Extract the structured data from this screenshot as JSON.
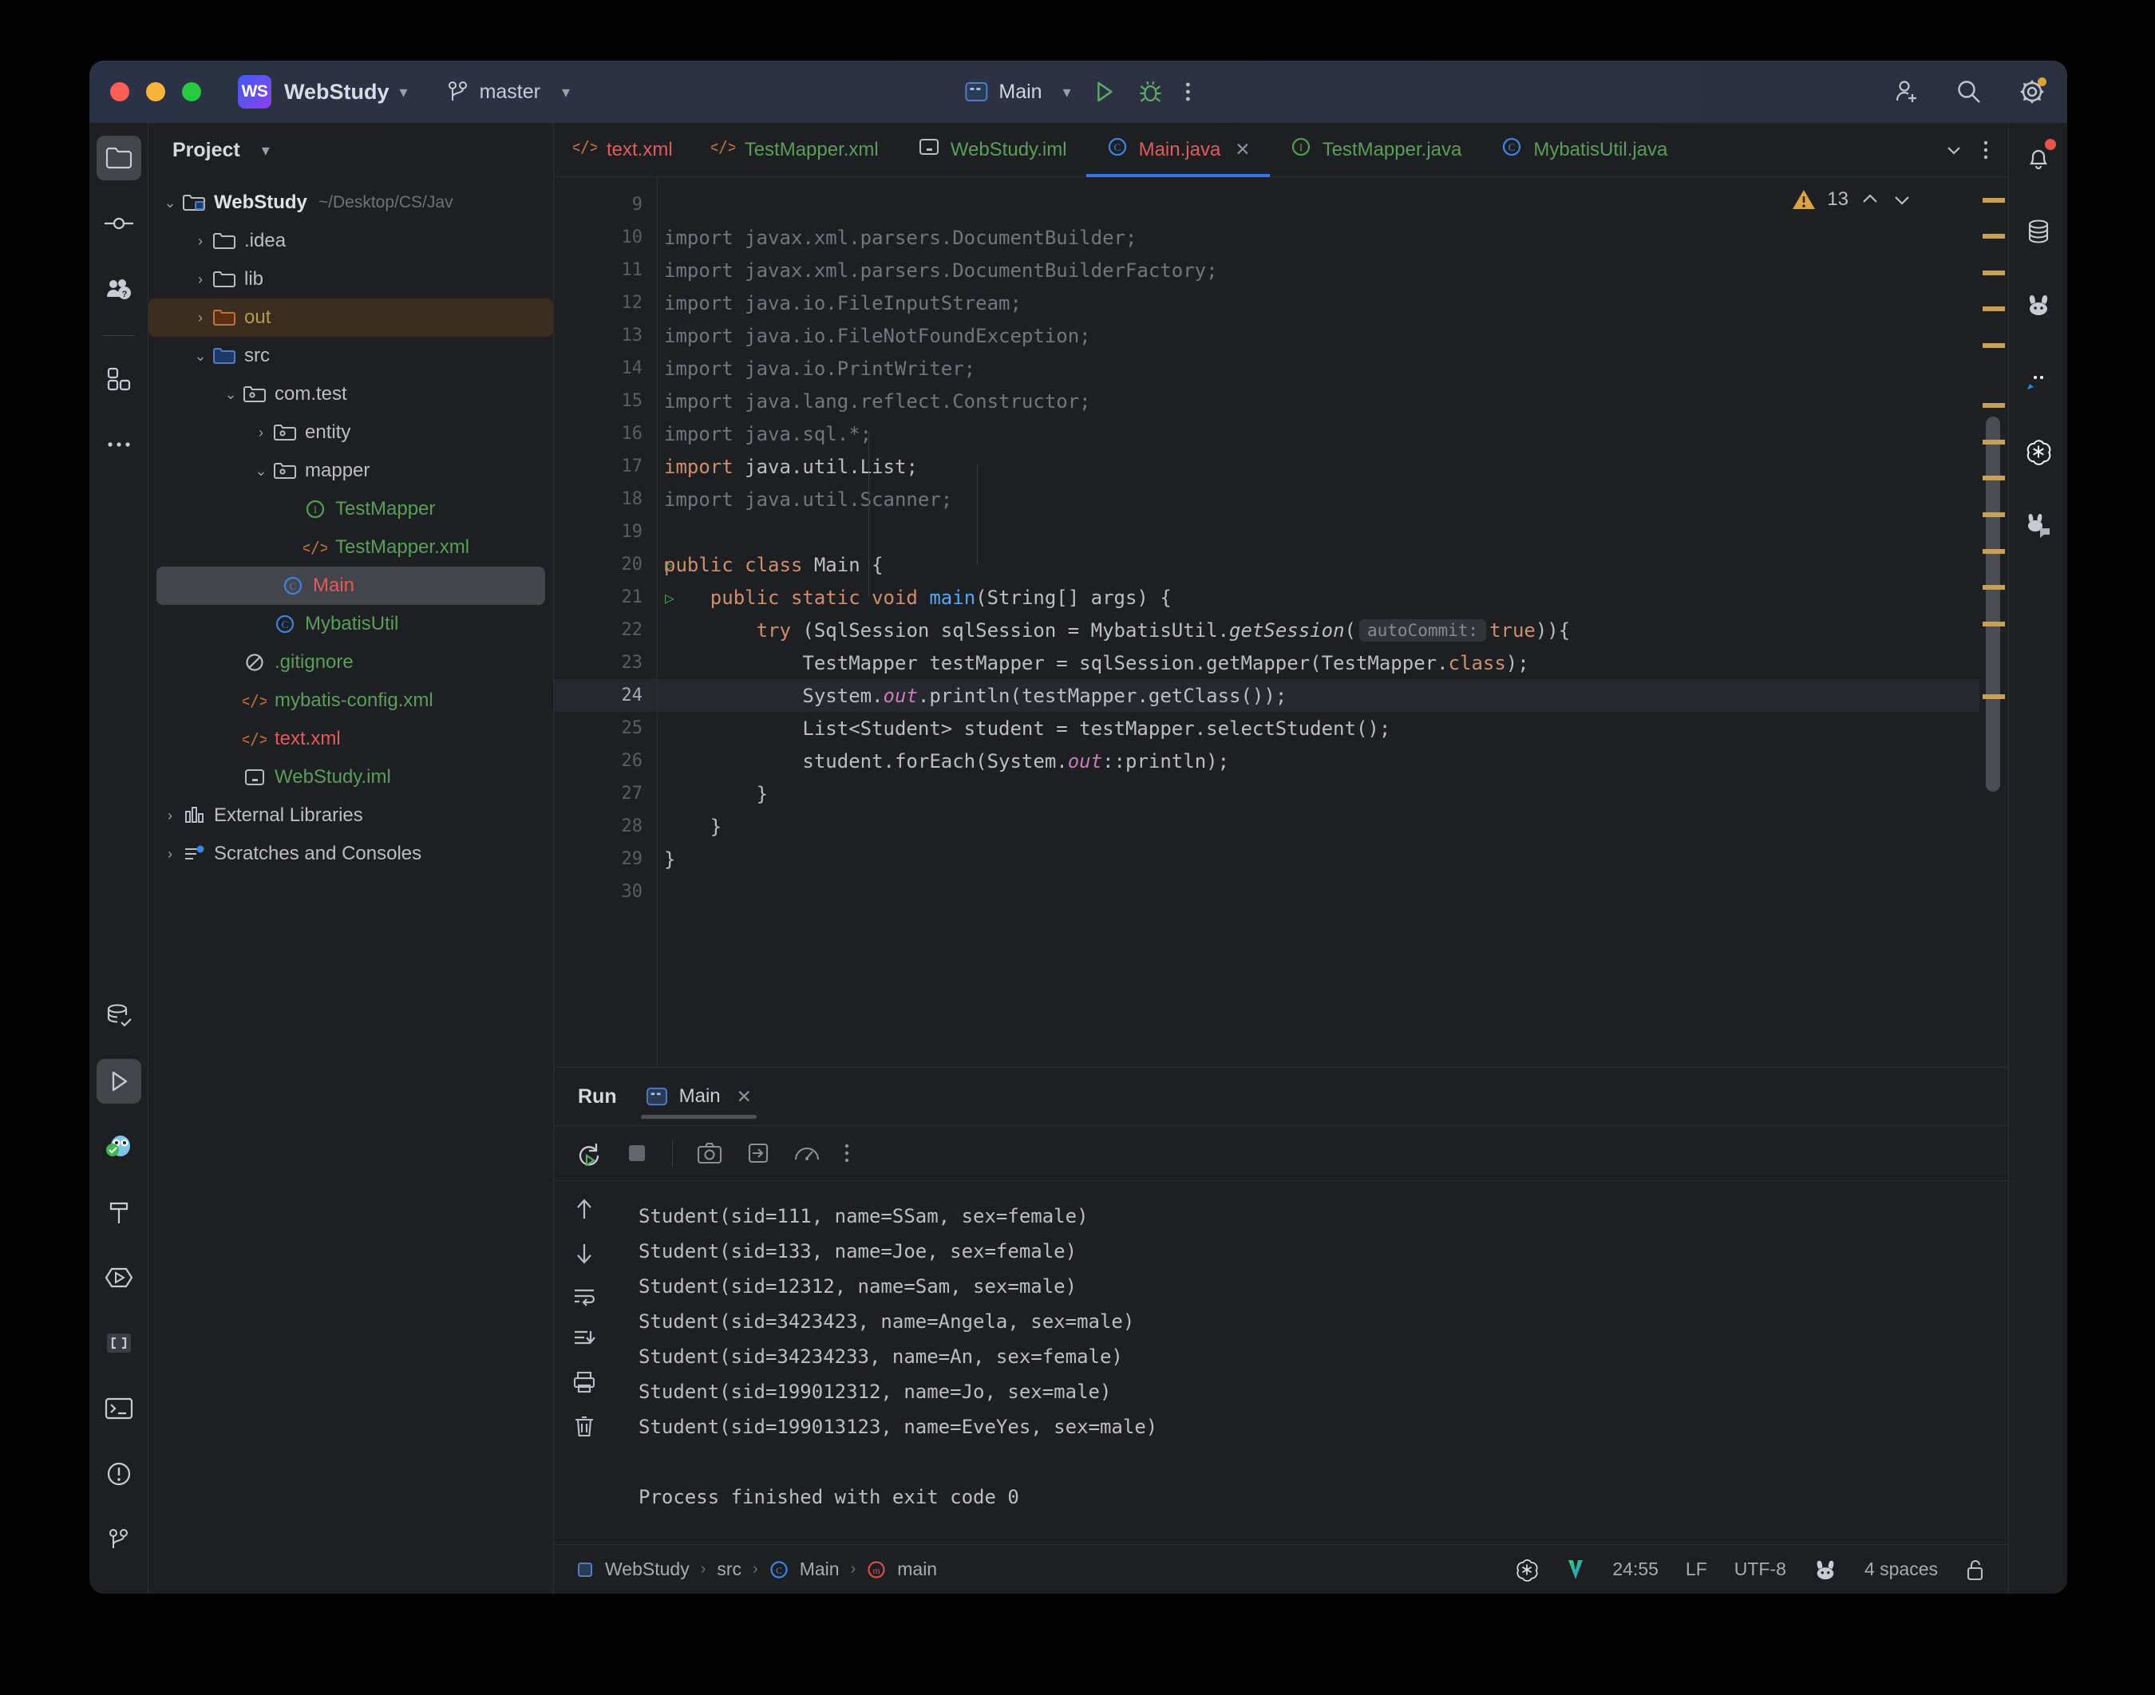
{
  "titlebar": {
    "app_badge": "WS",
    "project": "WebStudy",
    "branch": "master",
    "run_config": "Main",
    "icons": [
      "run-icon",
      "debug-icon",
      "more-actions-icon",
      "add-user-icon",
      "search-icon",
      "settings-icon"
    ]
  },
  "left_rail": {
    "items": [
      "project-icon",
      "commit-icon",
      "pull-requests-icon",
      "plugins-icon",
      "more-tool-windows-icon"
    ],
    "bottom": [
      "database-icon",
      "run-icon",
      "go-plugin-icon",
      "build-icon",
      "services-icon",
      "structure-icon",
      "terminal-icon",
      "problems-icon",
      "git-icon"
    ]
  },
  "project_panel": {
    "title": "Project",
    "tree": [
      {
        "label": "WebStudy",
        "path": "~/Desktop/CS/Jav",
        "depth": 0,
        "twisty": "down",
        "icon": "module-icon",
        "style": "bold"
      },
      {
        "label": ".idea",
        "depth": 1,
        "twisty": "right",
        "icon": "folder-icon",
        "style": "plain"
      },
      {
        "label": "lib",
        "depth": 1,
        "twisty": "right",
        "icon": "folder-icon",
        "style": "plain"
      },
      {
        "label": "out",
        "depth": 1,
        "twisty": "right",
        "icon": "folder-excluded-icon",
        "style": "yellow",
        "selected": "orange"
      },
      {
        "label": "src",
        "depth": 1,
        "twisty": "down",
        "icon": "folder-source-icon",
        "style": "plain"
      },
      {
        "label": "com.test",
        "depth": 2,
        "twisty": "down",
        "icon": "package-icon",
        "style": "plain"
      },
      {
        "label": "entity",
        "depth": 3,
        "twisty": "right",
        "icon": "package-icon",
        "style": "plain"
      },
      {
        "label": "mapper",
        "depth": 3,
        "twisty": "down",
        "icon": "package-icon",
        "style": "plain"
      },
      {
        "label": "TestMapper",
        "depth": 4,
        "twisty": "none",
        "icon": "interface-icon",
        "style": "green"
      },
      {
        "label": "TestMapper.xml",
        "depth": 4,
        "twisty": "none",
        "icon": "xml-icon",
        "style": "green"
      },
      {
        "label": "Main",
        "depth": 3,
        "twisty": "none",
        "icon": "class-icon",
        "style": "red",
        "selected": "grey"
      },
      {
        "label": "MybatisUtil",
        "depth": 3,
        "twisty": "none",
        "icon": "class-icon",
        "style": "green"
      },
      {
        "label": ".gitignore",
        "depth": 2,
        "twisty": "none",
        "icon": "gitignore-icon",
        "style": "green"
      },
      {
        "label": "mybatis-config.xml",
        "depth": 2,
        "twisty": "none",
        "icon": "xml-icon",
        "style": "green"
      },
      {
        "label": "text.xml",
        "depth": 2,
        "twisty": "none",
        "icon": "xml-icon",
        "style": "red"
      },
      {
        "label": "WebStudy.iml",
        "depth": 2,
        "twisty": "none",
        "icon": "iml-icon",
        "style": "green"
      },
      {
        "label": "External Libraries",
        "depth": 0,
        "twisty": "right",
        "icon": "libraries-icon",
        "style": "plain"
      },
      {
        "label": "Scratches and Consoles",
        "depth": 0,
        "twisty": "right",
        "icon": "scratches-icon",
        "style": "plain"
      }
    ]
  },
  "editor": {
    "tabs": [
      {
        "label": "text.xml",
        "icon": "xml-icon",
        "color": "red",
        "active": false
      },
      {
        "label": "TestMapper.xml",
        "icon": "xml-icon",
        "color": "green",
        "active": false
      },
      {
        "label": "WebStudy.iml",
        "icon": "iml-icon",
        "color": "green",
        "active": false
      },
      {
        "label": "Main.java",
        "icon": "class-icon",
        "color": "red",
        "active": true
      },
      {
        "label": "TestMapper.java",
        "icon": "interface-icon",
        "color": "green",
        "active": false
      },
      {
        "label": "MybatisUtil.java",
        "icon": "class-icon",
        "color": "green",
        "active": false
      }
    ],
    "warning_count": "13",
    "first_line_number": 9,
    "current_line": 24,
    "lines": [
      {
        "n": 9,
        "segs": []
      },
      {
        "n": 10,
        "segs": [
          {
            "t": "import javax.xml.parsers.DocumentBuilder;",
            "c": "dim"
          }
        ]
      },
      {
        "n": 11,
        "segs": [
          {
            "t": "import javax.xml.parsers.DocumentBuilderFactory;",
            "c": "dim"
          }
        ]
      },
      {
        "n": 12,
        "segs": [
          {
            "t": "import java.io.FileInputStream;",
            "c": "dim"
          }
        ]
      },
      {
        "n": 13,
        "segs": [
          {
            "t": "import java.io.FileNotFoundException;",
            "c": "dim"
          }
        ]
      },
      {
        "n": 14,
        "segs": [
          {
            "t": "import java.io.PrintWriter;",
            "c": "dim"
          }
        ]
      },
      {
        "n": 15,
        "segs": [
          {
            "t": "import java.lang.reflect.Constructor;",
            "c": "dim"
          }
        ]
      },
      {
        "n": 16,
        "segs": [
          {
            "t": "import java.sql.*;",
            "c": "dim"
          }
        ]
      },
      {
        "n": 17,
        "segs": [
          {
            "t": "import",
            "c": "kw"
          },
          {
            "t": " java.util.List;",
            "c": "plain"
          }
        ]
      },
      {
        "n": 18,
        "segs": [
          {
            "t": "import java.util.Scanner;",
            "c": "dim"
          }
        ]
      },
      {
        "n": 19,
        "segs": []
      },
      {
        "n": 20,
        "gutter_run": true,
        "segs": [
          {
            "t": "public class ",
            "c": "kw"
          },
          {
            "t": "Main {",
            "c": "plain"
          }
        ]
      },
      {
        "n": 21,
        "gutter_run": true,
        "segs": [
          {
            "t": "    public static void ",
            "c": "kw"
          },
          {
            "t": "main",
            "c": "fn"
          },
          {
            "t": "(String[] args) {",
            "c": "plain"
          }
        ]
      },
      {
        "n": 22,
        "segs": [
          {
            "t": "        ",
            "c": "plain"
          },
          {
            "t": "try",
            "c": "kw"
          },
          {
            "t": " (SqlSession sqlSession = MybatisUtil.",
            "c": "plain"
          },
          {
            "t": "getSession",
            "c": "ital"
          },
          {
            "t": "(",
            "c": "plain"
          },
          {
            "t": "autoCommit:",
            "c": "hint"
          },
          {
            "t": "true",
            "c": "kw"
          },
          {
            "t": ")){",
            "c": "plain"
          }
        ]
      },
      {
        "n": 23,
        "segs": [
          {
            "t": "            TestMapper testMapper = sqlSession.getMapper(TestMapper.",
            "c": "plain"
          },
          {
            "t": "class",
            "c": "kw"
          },
          {
            "t": ");",
            "c": "plain"
          }
        ]
      },
      {
        "n": 24,
        "segs": [
          {
            "t": "            System.",
            "c": "plain"
          },
          {
            "t": "out",
            "c": "field"
          },
          {
            "t": ".println(testMapper.getClass());",
            "c": "plain"
          }
        ]
      },
      {
        "n": 25,
        "segs": [
          {
            "t": "            List<Student> student = testMapper.selectStudent();",
            "c": "plain"
          }
        ]
      },
      {
        "n": 26,
        "segs": [
          {
            "t": "            student.forEach(System.",
            "c": "plain"
          },
          {
            "t": "out",
            "c": "field"
          },
          {
            "t": "::println);",
            "c": "plain"
          }
        ]
      },
      {
        "n": 27,
        "segs": [
          {
            "t": "        }",
            "c": "plain"
          }
        ]
      },
      {
        "n": 28,
        "segs": [
          {
            "t": "    }",
            "c": "plain"
          }
        ]
      },
      {
        "n": 29,
        "segs": [
          {
            "t": "}",
            "c": "plain"
          }
        ]
      },
      {
        "n": 30,
        "segs": []
      }
    ],
    "stripe_marks_y": [
      26,
      71,
      117,
      162,
      208,
      283,
      329,
      374,
      420,
      466,
      511,
      557,
      648
    ]
  },
  "run_panel": {
    "title": "Run",
    "tab_label": "Main",
    "toolbar_icons": [
      "rerun-icon",
      "stop-icon",
      "screenshot-icon",
      "import-icon",
      "profiler-icon",
      "more-icon"
    ],
    "side_icons": [
      "scroll-up-icon",
      "scroll-down-icon",
      "soft-wrap-icon",
      "scroll-to-end-icon",
      "print-icon",
      "clear-all-icon"
    ],
    "console_lines": [
      "Student(sid=111, name=SSam, sex=female)",
      "Student(sid=133, name=Joe, sex=female)",
      "Student(sid=12312, name=Sam, sex=male)",
      "Student(sid=3423423, name=Angela, sex=male)",
      "Student(sid=34234233, name=An, sex=female)",
      "Student(sid=199012312, name=Jo, sex=male)",
      "Student(sid=199013123, name=EveYes, sex=male)",
      "",
      "Process finished with exit code 0"
    ]
  },
  "statusbar": {
    "breadcrumb": [
      "WebStudy",
      "src",
      "Main",
      "main"
    ],
    "position": "24:55",
    "line_separator": "LF",
    "encoding": "UTF-8",
    "indent": "4 spaces",
    "right_icons": [
      "openai-icon",
      "v-icon",
      "bunny-icon",
      "lock-icon"
    ]
  },
  "right_rail": {
    "items": [
      "notifications-icon",
      "database-icon",
      "bunny-icon",
      "chat-icon",
      "openai-icon",
      "ai-assistant-icon"
    ]
  },
  "colors": {
    "accent": "#3574f0",
    "warning": "#c7a256",
    "added": "#5a9e5a",
    "modified": "#e05c5c"
  }
}
